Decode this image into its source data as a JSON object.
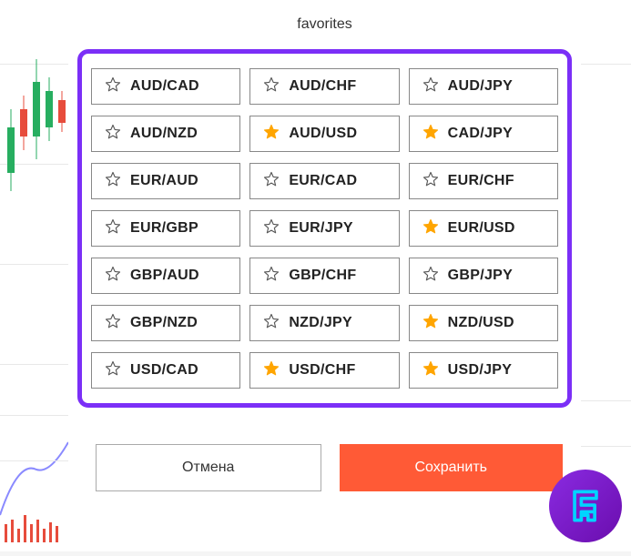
{
  "title": "favorites",
  "pairs": [
    {
      "label": "AUD/CAD",
      "favorite": false
    },
    {
      "label": "AUD/CHF",
      "favorite": false
    },
    {
      "label": "AUD/JPY",
      "favorite": false
    },
    {
      "label": "AUD/NZD",
      "favorite": false
    },
    {
      "label": "AUD/USD",
      "favorite": true
    },
    {
      "label": "CAD/JPY",
      "favorite": true
    },
    {
      "label": "EUR/AUD",
      "favorite": false
    },
    {
      "label": "EUR/CAD",
      "favorite": false
    },
    {
      "label": "EUR/CHF",
      "favorite": false
    },
    {
      "label": "EUR/GBP",
      "favorite": false
    },
    {
      "label": "EUR/JPY",
      "favorite": false
    },
    {
      "label": "EUR/USD",
      "favorite": true
    },
    {
      "label": "GBP/AUD",
      "favorite": false
    },
    {
      "label": "GBP/CHF",
      "favorite": false
    },
    {
      "label": "GBP/JPY",
      "favorite": false
    },
    {
      "label": "GBP/NZD",
      "favorite": false
    },
    {
      "label": "NZD/JPY",
      "favorite": false
    },
    {
      "label": "NZD/USD",
      "favorite": true
    },
    {
      "label": "USD/CAD",
      "favorite": false
    },
    {
      "label": "USD/CHF",
      "favorite": true
    },
    {
      "label": "USD/JPY",
      "favorite": true
    }
  ],
  "buttons": {
    "cancel": "Отмена",
    "save": "Сохранить"
  },
  "colors": {
    "accent_border": "#7b2ff7",
    "save_button": "#ff5a36",
    "star_filled": "#ffa500",
    "star_empty": "#555"
  }
}
